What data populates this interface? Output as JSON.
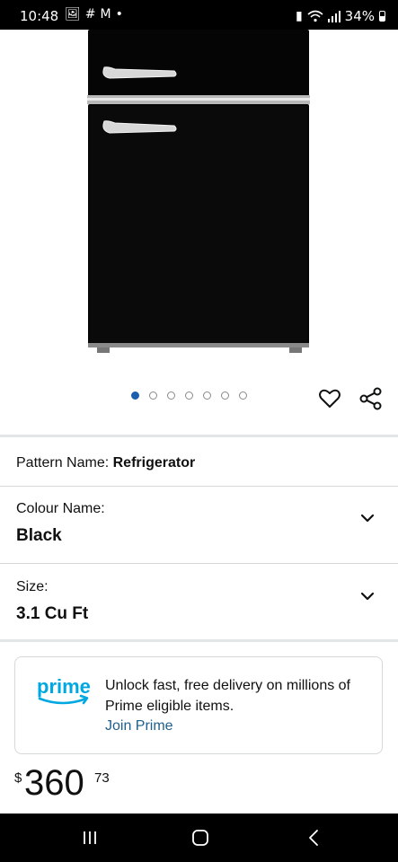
{
  "status_bar": {
    "time": "10:48",
    "battery": "34%"
  },
  "gallery": {
    "count": 7,
    "active_index": 0
  },
  "pattern": {
    "label": "Pattern Name:",
    "value": "Refrigerator"
  },
  "colour": {
    "label": "Colour Name:",
    "value": "Black"
  },
  "size": {
    "label": "Size:",
    "value": "3.1 Cu Ft"
  },
  "prime": {
    "logo_text": "prime",
    "message": "Unlock fast, free delivery on millions of Prime eligible items.",
    "link": "Join Prime"
  },
  "price": {
    "currency": "$",
    "whole": "360",
    "fraction": "73"
  },
  "colors": {
    "accent": "#1b5faf",
    "prime_blue": "#00a8e1",
    "link": "#1f5f8b"
  }
}
